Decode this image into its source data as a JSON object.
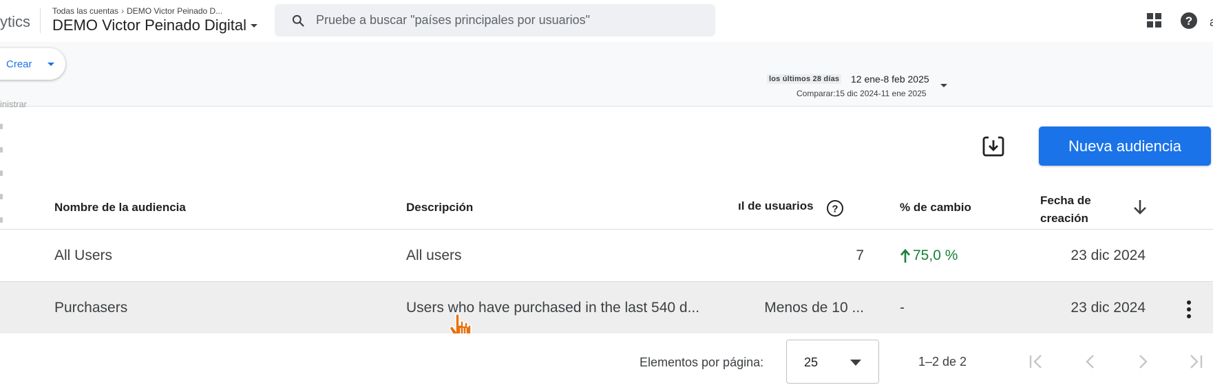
{
  "topbar": {
    "app_name_partial": "ytics",
    "breadcrumb_parent": "Todas las cuentas",
    "breadcrumb_child": "DEMO Victor Peinado D...",
    "property_name": "DEMO Victor Peinado Digital",
    "search_placeholder": "Pruebe a buscar \"países principales por usuarios\"",
    "edge_char": "a"
  },
  "subheader": {
    "create_label": "Crear",
    "left_partial": "inistrar",
    "date_chip": "los últimos 28 días",
    "date_range": "12 ene-8 feb 2025",
    "compare": "Comparar:15 dic 2024-11 ene 2025"
  },
  "actions": {
    "new_audience_label": "Nueva audiencia"
  },
  "table": {
    "headers": {
      "name": "Nombre de la audiencia",
      "description": "Descripción",
      "users": "ıl de usuarios",
      "change": "% de cambio",
      "date_line1": "Fecha de",
      "date_line2": "creación"
    },
    "rows": [
      {
        "name": "All Users",
        "description": "All users",
        "users": "7",
        "change": "75,0 %",
        "change_direction": "up",
        "date": "23 dic 2024"
      },
      {
        "name": "Purchasers",
        "description": "Users who have purchased in the last 540 d...",
        "users": "Menos de 10 ...",
        "change": "-",
        "date": "23 dic 2024"
      }
    ]
  },
  "pagination": {
    "per_page_label": "Elementos por página:",
    "page_size": "25",
    "range": "1–2 de 2"
  },
  "colors": {
    "accent": "#1a73e8",
    "positive": "#188038",
    "row_hover": "#eeeeee"
  }
}
